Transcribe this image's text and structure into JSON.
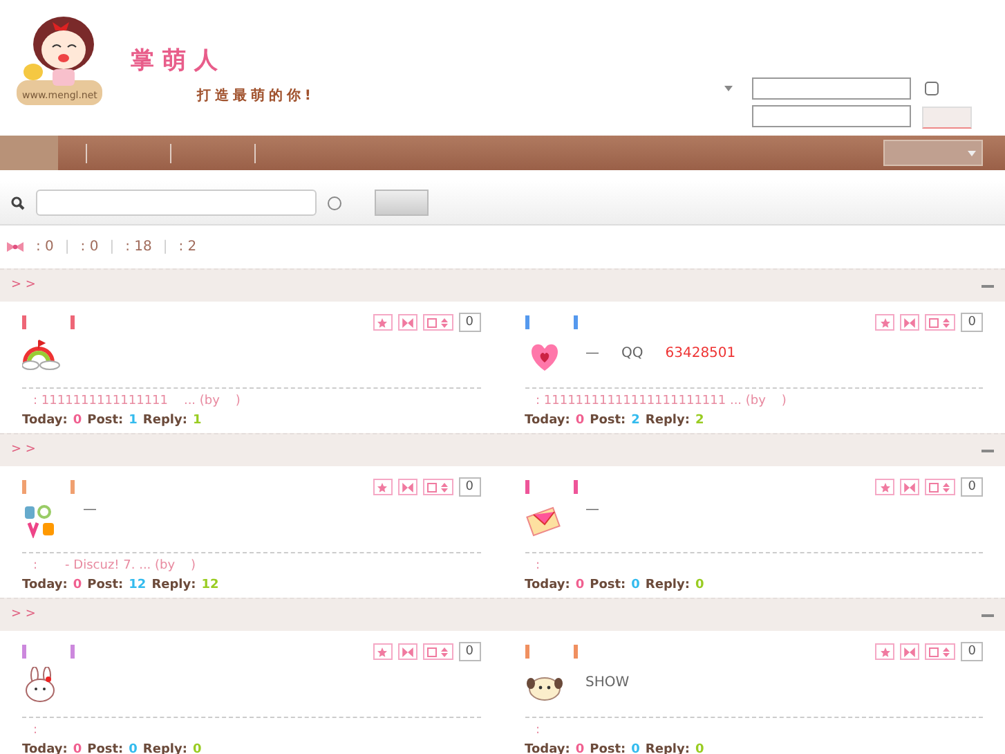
{
  "header": {
    "site_name": "掌萌人",
    "slogan": "打造最萌的你!",
    "url": "www.mengl.net",
    "remember_checked": false
  },
  "nav": {
    "items": [
      {
        "selected": true
      },
      {
        "selected": false
      },
      {
        "selected": false
      },
      {
        "selected": false
      }
    ]
  },
  "search": {
    "scope_selected": false
  },
  "stats": [
    {
      "kind": "value",
      "text": ": 0"
    },
    {
      "kind": "divider",
      "text": "|"
    },
    {
      "kind": "value",
      "text": ": 0"
    },
    {
      "kind": "divider",
      "text": "|"
    },
    {
      "kind": "value",
      "text": ": 18"
    },
    {
      "kind": "divider",
      "text": "|"
    },
    {
      "kind": "value",
      "text": ": 2"
    }
  ],
  "sections": [
    {
      "crumb": "> >",
      "forums": [
        {
          "color": "#ee6677",
          "kind": "rainbow",
          "last": ": 1111111111111111    ... (by    )",
          "count": "0",
          "stats": [
            {
              "kind": "today",
              "label": "Today:",
              "value": "0"
            },
            {
              "kind": "post",
              "label": "Post:",
              "value": "1"
            },
            {
              "kind": "reply",
              "label": "Reply:",
              "value": "1"
            }
          ]
        },
        {
          "color": "#5599ee",
          "kind": "heart",
          "extra": [
            "—",
            "QQ",
            "63428501"
          ],
          "last": ": 11111111111111111111111 ... (by    )",
          "count": "0",
          "stats": [
            {
              "kind": "today",
              "label": "Today:",
              "value": "0"
            },
            {
              "kind": "post",
              "label": "Post:",
              "value": "2"
            },
            {
              "kind": "reply",
              "label": "Reply:",
              "value": "2"
            }
          ]
        }
      ]
    },
    {
      "crumb": "> >",
      "forums": [
        {
          "color": "#f0a070",
          "kind": "love",
          "extra": [
            "—"
          ],
          "last": ":       - Discuz! 7. ... (by    )",
          "count": "0",
          "stats": [
            {
              "kind": "today",
              "label": "Today:",
              "value": "0"
            },
            {
              "kind": "post",
              "label": "Post:",
              "value": "12"
            },
            {
              "kind": "reply",
              "label": "Reply:",
              "value": "12"
            }
          ]
        },
        {
          "color": "#ee5599",
          "kind": "envelope",
          "extra": [
            "—"
          ],
          "last": ":",
          "count": "0",
          "stats": [
            {
              "kind": "today",
              "label": "Today:",
              "value": "0"
            },
            {
              "kind": "post",
              "label": "Post:",
              "value": "0"
            },
            {
              "kind": "reply",
              "label": "Reply:",
              "value": "0"
            }
          ]
        }
      ]
    },
    {
      "crumb": "> >",
      "forums": [
        {
          "color": "#cc88dd",
          "kind": "bunny",
          "last": ":",
          "count": "0",
          "stats": [
            {
              "kind": "today",
              "label": "Today:",
              "value": "0"
            },
            {
              "kind": "post",
              "label": "Post:",
              "value": "0"
            },
            {
              "kind": "reply",
              "label": "Reply:",
              "value": "0"
            }
          ]
        },
        {
          "color": "#f09060",
          "kind": "dog",
          "extra": [
            "SHOW"
          ],
          "last": ":",
          "count": "0",
          "stats": [
            {
              "kind": "today",
              "label": "Today:",
              "value": "0"
            },
            {
              "kind": "post",
              "label": "Post:",
              "value": "0"
            },
            {
              "kind": "reply",
              "label": "Reply:",
              "value": "0"
            }
          ]
        }
      ]
    }
  ]
}
